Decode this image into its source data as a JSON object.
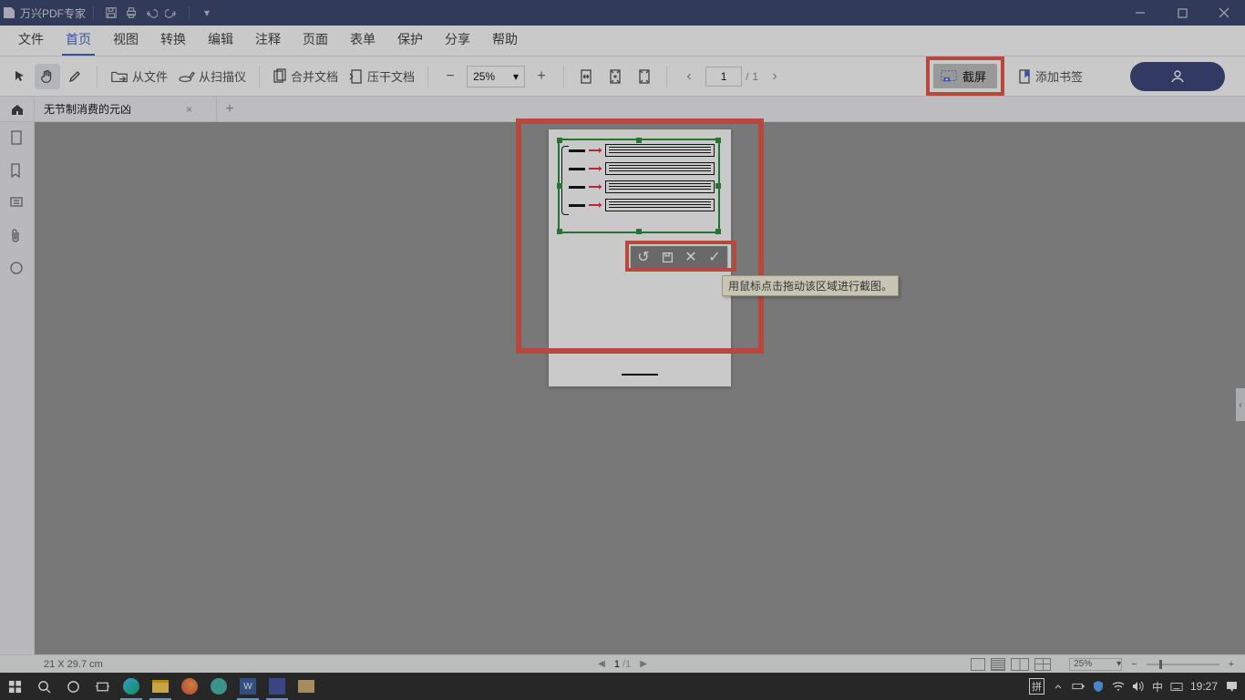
{
  "app": {
    "title": "万兴PDF专家"
  },
  "menu": {
    "items": [
      "文件",
      "首页",
      "视图",
      "转换",
      "编辑",
      "注释",
      "页面",
      "表单",
      "保护",
      "分享",
      "帮助"
    ],
    "active_index": 1
  },
  "toolbar": {
    "from_file": "从文件",
    "from_scanner": "从扫描仪",
    "merge": "合并文档",
    "compress": "压干文档",
    "zoom_value": "25%",
    "page_current": "1",
    "page_sep": "/",
    "page_total": "1",
    "screenshot": "截屏",
    "add_bookmark": "添加书签"
  },
  "tabs": {
    "file_name": "无节制消费的元凶",
    "close_glyph": "×",
    "add_glyph": "+"
  },
  "crop_toolbar": {
    "undo_glyph": "↺",
    "cancel_glyph": "✕",
    "confirm_glyph": "✓"
  },
  "tooltip": {
    "text": "用鼠标点击拖动该区域进行截图。"
  },
  "statusbar": {
    "size": "21 X 29.7 cm",
    "page_current": "1",
    "page_sep": "/",
    "page_total": "1",
    "zoom_value": "25%"
  },
  "taskbar": {
    "ime": "拼",
    "lang": "中",
    "time": "19:27"
  },
  "glyph": {
    "caret": "▾",
    "chev_l": "‹",
    "chev_r": "›",
    "minus": "−",
    "plus": "+",
    "tri_l": "◀",
    "tri_r": "▶"
  }
}
